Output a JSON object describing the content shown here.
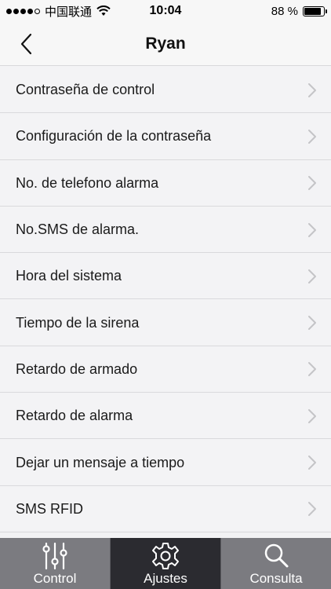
{
  "status_bar": {
    "carrier": "中国联通",
    "time": "10:04",
    "battery_text": "88 %",
    "battery_level": 0.88
  },
  "nav": {
    "title": "Ryan",
    "back_icon": "chevron-left-icon"
  },
  "settings": {
    "items": [
      {
        "label": "Contraseña de control"
      },
      {
        "label": "Configuración de la contraseña"
      },
      {
        "label": "No. de telefono alarma"
      },
      {
        "label": "No.SMS de alarma."
      },
      {
        "label": "Hora del sistema"
      },
      {
        "label": "Tiempo de la sirena"
      },
      {
        "label": "Retardo de armado"
      },
      {
        "label": "Retardo de alarma"
      },
      {
        "label": "Dejar un mensaje a tiempo"
      },
      {
        "label": "SMS RFID"
      }
    ]
  },
  "tab_bar": {
    "tabs": [
      {
        "label": "Control",
        "icon": "sliders-icon",
        "active": false
      },
      {
        "label": "Ajustes",
        "icon": "gear-icon",
        "active": true
      },
      {
        "label": "Consulta",
        "icon": "search-icon",
        "active": false
      }
    ]
  },
  "colors": {
    "background": "#f3f3f5",
    "tab_bar": "#7b7b80",
    "tab_active": "#2b2b30",
    "chevron": "#c4c4c7"
  }
}
